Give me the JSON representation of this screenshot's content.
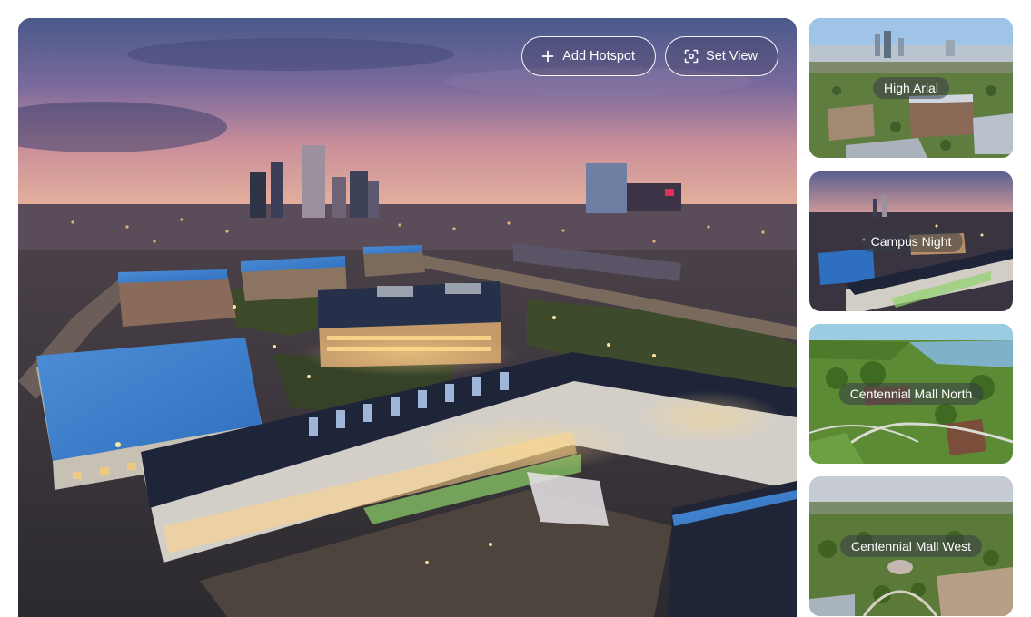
{
  "viewer": {
    "toolbar": {
      "add_hotspot_label": "Add Hotspot",
      "set_view_label": "Set View"
    },
    "icons": {
      "add": "plus-icon",
      "set_view": "focus-frame-icon"
    }
  },
  "scenes": [
    {
      "label": "High Arial"
    },
    {
      "label": "Campus Night"
    },
    {
      "label": "Centennial Mall North"
    },
    {
      "label": "Centennial Mall West"
    }
  ],
  "colors": {
    "button_border": "#ffffff",
    "label_bg": "#373c46",
    "label_text": "#ffffff"
  }
}
